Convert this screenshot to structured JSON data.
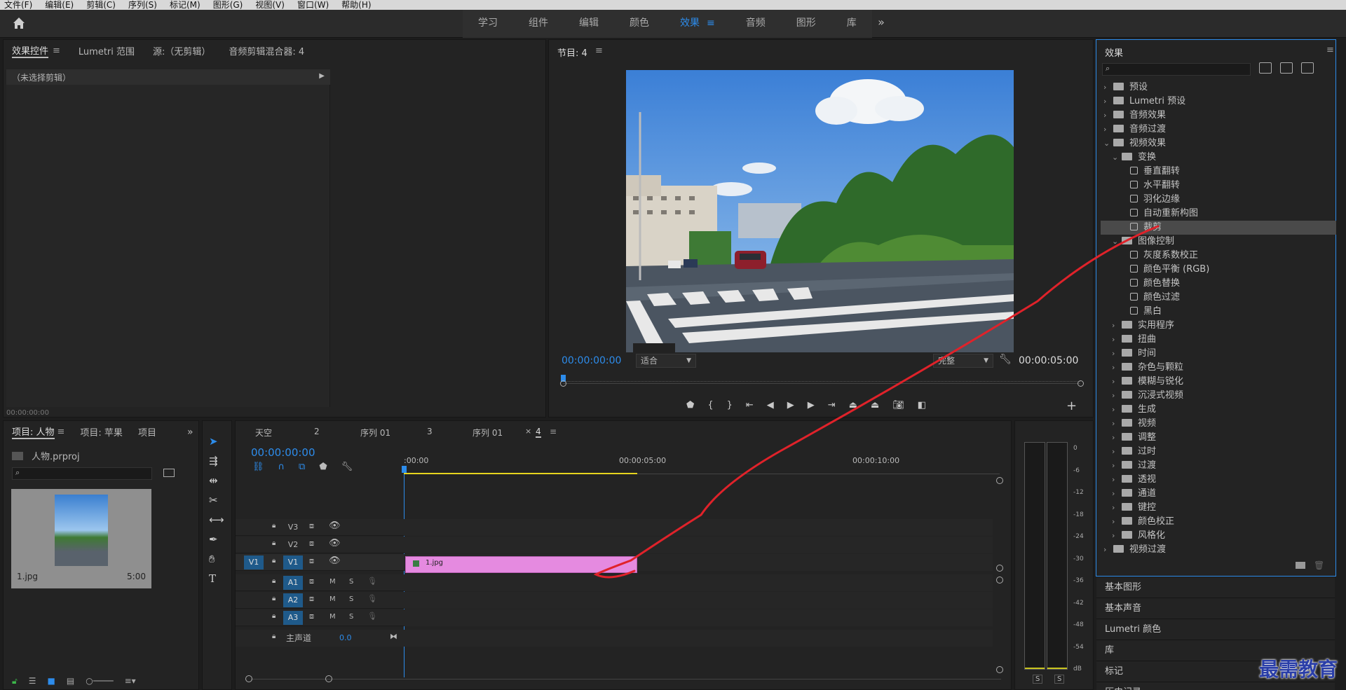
{
  "menu": [
    "文件(F)",
    "编辑(E)",
    "剪辑(C)",
    "序列(S)",
    "标记(M)",
    "图形(G)",
    "视图(V)",
    "窗口(W)",
    "帮助(H)"
  ],
  "workspaces": [
    "学习",
    "组件",
    "编辑",
    "颜色",
    "效果",
    "音频",
    "图形",
    "库"
  ],
  "workspace_active_index": 4,
  "more_glyph": "»",
  "effect_controls": {
    "tabs": [
      "效果控件",
      "Lumetri 范围",
      "源:（无剪辑）",
      "音频剪辑混合器: 4"
    ],
    "no_clip": "（未选择剪辑）",
    "timecode": "00:00:00:00"
  },
  "program": {
    "title": "节目: 4",
    "timecode_left": "00:00:00:00",
    "fit": "适合",
    "quality": "完整",
    "timecode_right": "00:00:05:00"
  },
  "effects_panel": {
    "title": "效果",
    "tree": [
      {
        "label": "预设",
        "level": 0,
        "type": "folder",
        "open": false
      },
      {
        "label": "Lumetri 预设",
        "level": 0,
        "type": "folder",
        "open": false
      },
      {
        "label": "音频效果",
        "level": 0,
        "type": "folder",
        "open": false
      },
      {
        "label": "音频过渡",
        "level": 0,
        "type": "folder",
        "open": false
      },
      {
        "label": "视频效果",
        "level": 0,
        "type": "folder",
        "open": true
      },
      {
        "label": "变换",
        "level": 1,
        "type": "folder",
        "open": true
      },
      {
        "label": "垂直翻转",
        "level": 2,
        "type": "fx"
      },
      {
        "label": "水平翻转",
        "level": 2,
        "type": "fx"
      },
      {
        "label": "羽化边缘",
        "level": 2,
        "type": "fx"
      },
      {
        "label": "自动重新构图",
        "level": 2,
        "type": "fx"
      },
      {
        "label": "裁剪",
        "level": 2,
        "type": "fx",
        "selected": true
      },
      {
        "label": "图像控制",
        "level": 1,
        "type": "folder",
        "open": true
      },
      {
        "label": "灰度系数校正",
        "level": 2,
        "type": "fx"
      },
      {
        "label": "颜色平衡 (RGB)",
        "level": 2,
        "type": "fx"
      },
      {
        "label": "颜色替换",
        "level": 2,
        "type": "fx"
      },
      {
        "label": "颜色过滤",
        "level": 2,
        "type": "fx"
      },
      {
        "label": "黑白",
        "level": 2,
        "type": "fx"
      },
      {
        "label": "实用程序",
        "level": 1,
        "type": "folder",
        "open": false
      },
      {
        "label": "扭曲",
        "level": 1,
        "type": "folder",
        "open": false
      },
      {
        "label": "时间",
        "level": 1,
        "type": "folder",
        "open": false
      },
      {
        "label": "杂色与颗粒",
        "level": 1,
        "type": "folder",
        "open": false
      },
      {
        "label": "模糊与锐化",
        "level": 1,
        "type": "folder",
        "open": false
      },
      {
        "label": "沉浸式视频",
        "level": 1,
        "type": "folder",
        "open": false
      },
      {
        "label": "生成",
        "level": 1,
        "type": "folder",
        "open": false
      },
      {
        "label": "视频",
        "level": 1,
        "type": "folder",
        "open": false
      },
      {
        "label": "调整",
        "level": 1,
        "type": "folder",
        "open": false
      },
      {
        "label": "过时",
        "level": 1,
        "type": "folder",
        "open": false
      },
      {
        "label": "过渡",
        "level": 1,
        "type": "folder",
        "open": false
      },
      {
        "label": "透视",
        "level": 1,
        "type": "folder",
        "open": false
      },
      {
        "label": "通道",
        "level": 1,
        "type": "folder",
        "open": false
      },
      {
        "label": "键控",
        "level": 1,
        "type": "folder",
        "open": false
      },
      {
        "label": "颜色校正",
        "level": 1,
        "type": "folder",
        "open": false
      },
      {
        "label": "风格化",
        "level": 1,
        "type": "folder",
        "open": false
      },
      {
        "label": "视频过渡",
        "level": 0,
        "type": "folder",
        "open": false
      }
    ]
  },
  "side_panels": [
    "基本图形",
    "基本声音",
    "Lumetri 颜色",
    "库",
    "标记",
    "历史记录"
  ],
  "project": {
    "tabs": [
      "项目: 人物",
      "项目: 苹果",
      "项目"
    ],
    "file": "人物.prproj",
    "clip_name": "1.jpg",
    "clip_duration": "5:00"
  },
  "timeline": {
    "tabs": [
      "天空",
      "2",
      "序列 01",
      "3",
      "序列 01",
      "4"
    ],
    "timecode": "00:00:00:00",
    "ruler": [
      ":00:00",
      "00:00:05:00",
      "00:00:10:00"
    ],
    "video_tracks": [
      "V3",
      "V2",
      "V1"
    ],
    "audio_tracks": [
      "A1",
      "A2",
      "A3"
    ],
    "source_patch_v": "V1",
    "master_label": "主声道",
    "master_value": "0.0",
    "clip_label": "1.jpg",
    "m": "M",
    "s": "S"
  },
  "meter": {
    "ticks": [
      "0",
      "-6",
      "-12",
      "-18",
      "-24",
      "-30",
      "-36",
      "-42",
      "-48",
      "-54",
      "dB"
    ],
    "solo": [
      "S",
      "S"
    ]
  },
  "watermark": "最需教育",
  "colors": {
    "accent": "#2d8ceb",
    "clip": "#e58ae0",
    "annotation": "#e0222a"
  }
}
